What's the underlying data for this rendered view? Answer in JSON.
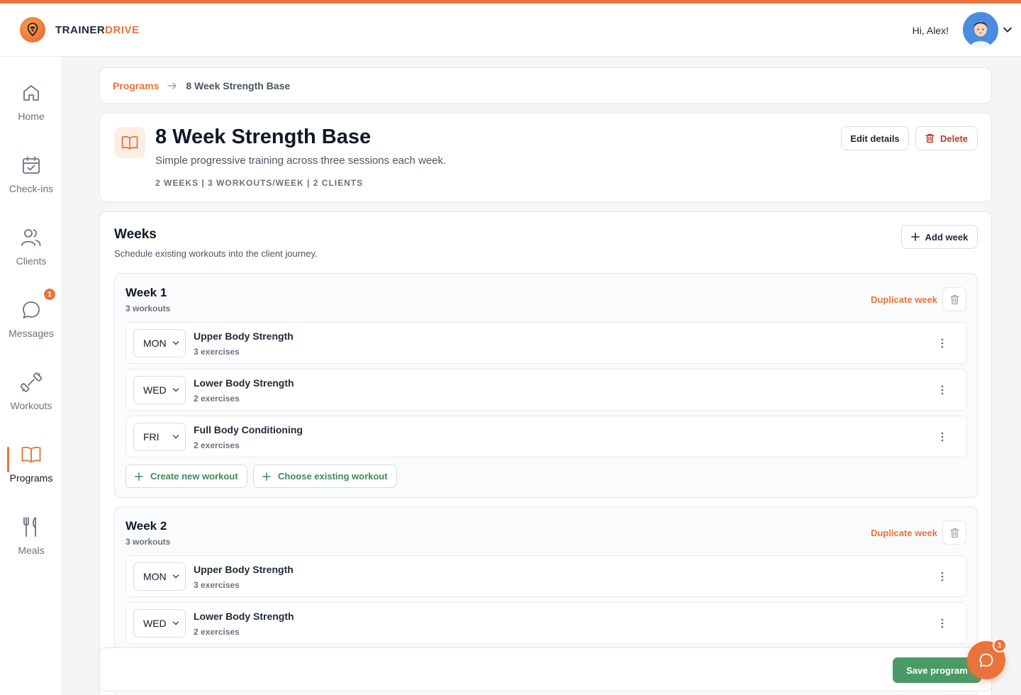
{
  "brand": {
    "name_part1": "TRAINER",
    "name_part2": "DRIVE",
    "accent": "#e8743b"
  },
  "header": {
    "greeting": "Hi, Alex!",
    "avatar_icon": "user-avatar",
    "menu_icon": "chevron-down-icon"
  },
  "sidebar": {
    "items": [
      {
        "label": "Home",
        "icon": "home-icon"
      },
      {
        "label": "Check-ins",
        "icon": "calendar-check-icon"
      },
      {
        "label": "Clients",
        "icon": "users-icon"
      },
      {
        "label": "Messages",
        "icon": "chat-bubble-icon",
        "badge": "1"
      },
      {
        "label": "Workouts",
        "icon": "dumbbell-icon"
      },
      {
        "label": "Programs",
        "icon": "book-open-icon",
        "active": true
      },
      {
        "label": "Meals",
        "icon": "fork-knife-icon"
      }
    ]
  },
  "breadcrumb": {
    "parent": "Programs",
    "current": "8 Week Strength Base"
  },
  "program": {
    "title": "8 Week Strength Base",
    "description": "Simple progressive training across three sessions each week.",
    "meta": "2 WEEKS | 3 WORKOUTS/WEEK | 2 CLIENTS",
    "edit_label": "Edit details",
    "delete_label": "Delete"
  },
  "weeks_section": {
    "title": "Weeks",
    "subtitle": "Schedule existing workouts into the client journey.",
    "add_week_label": "Add week",
    "duplicate_label": "Duplicate week",
    "create_workout_label": "Create new workout",
    "choose_workout_label": "Choose existing workout",
    "weeks": [
      {
        "title": "Week 1",
        "count": "3 workouts",
        "workouts": [
          {
            "day": "MON",
            "name": "Upper Body Strength",
            "exercises": "3 exercises"
          },
          {
            "day": "WED",
            "name": "Lower Body Strength",
            "exercises": "2 exercises"
          },
          {
            "day": "FRI",
            "name": "Full Body Conditioning",
            "exercises": "2 exercises"
          }
        ]
      },
      {
        "title": "Week 2",
        "count": "3 workouts",
        "workouts": [
          {
            "day": "MON",
            "name": "Upper Body Strength",
            "exercises": "3 exercises"
          },
          {
            "day": "WED",
            "name": "Lower Body Strength",
            "exercises": "2 exercises"
          }
        ]
      }
    ]
  },
  "footer": {
    "save_label": "Save program",
    "chat_badge": "1"
  }
}
